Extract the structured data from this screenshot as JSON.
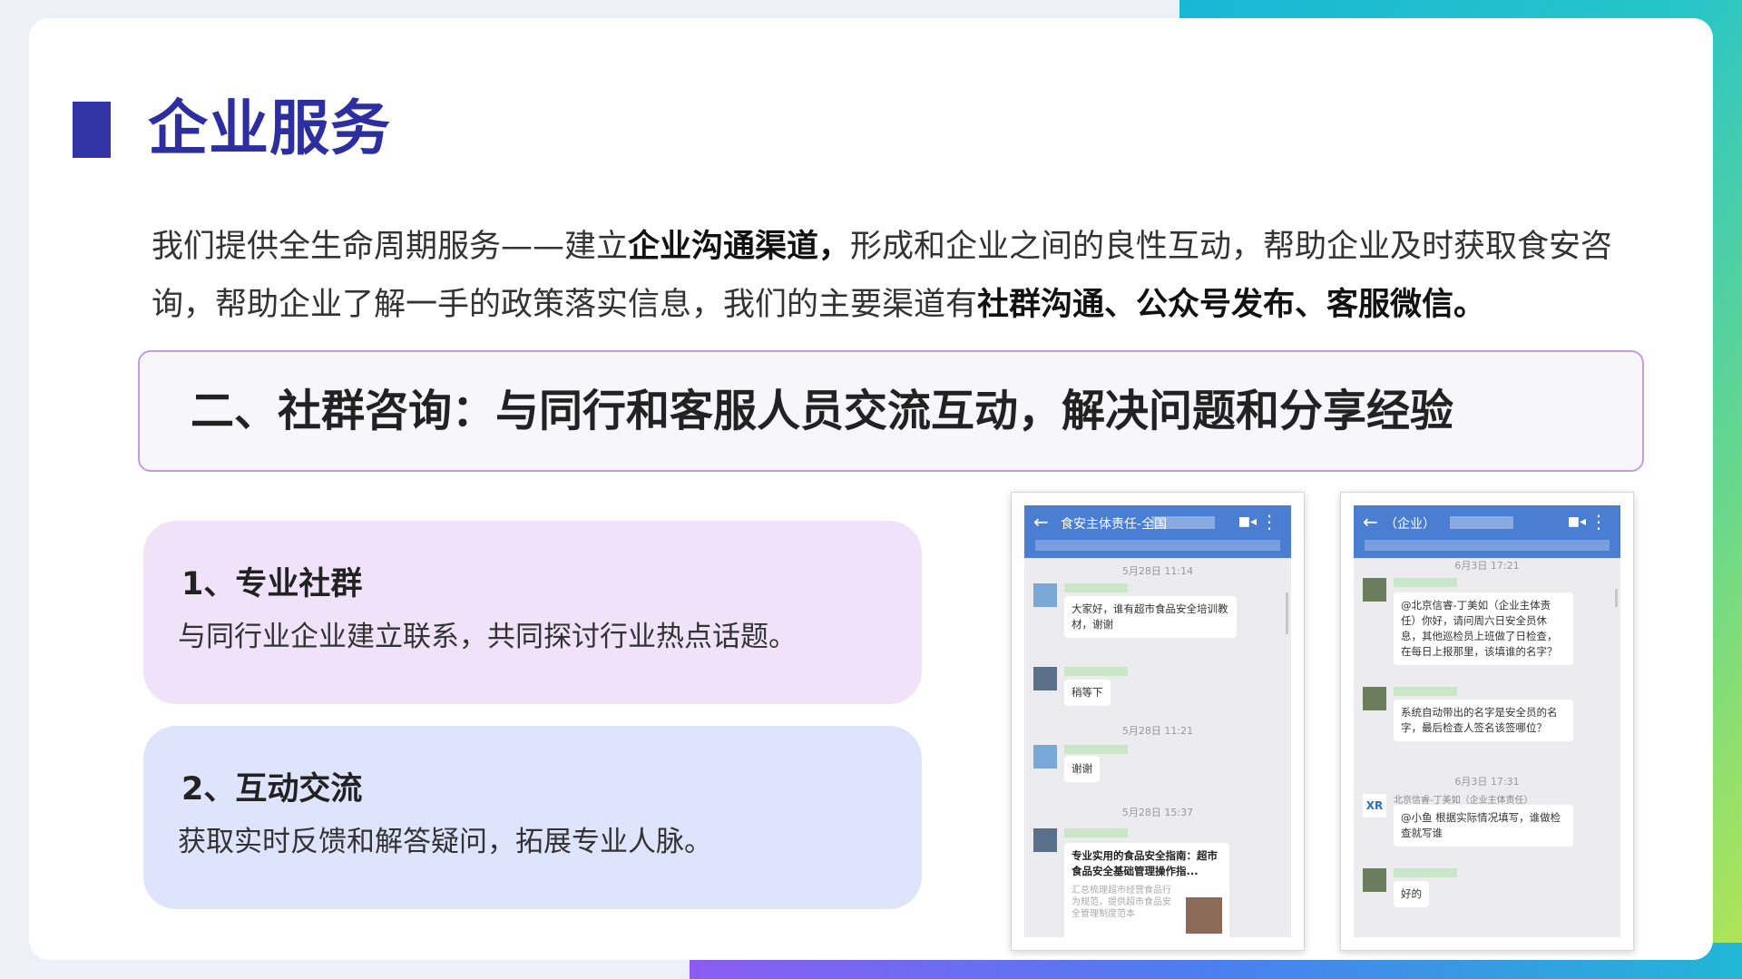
{
  "page": {
    "title": "企业服务",
    "intro_parts": [
      {
        "text": "我们提供全生命周期服务——建立",
        "bold": false
      },
      {
        "text": "企业沟通渠道，",
        "bold": true
      },
      {
        "text": "形成和企业之间的良性互动，帮助企业及时获取食安咨询，帮助企业了解一手的政策落实信息，我们的主要渠道有",
        "bold": false
      },
      {
        "text": "社群沟通、公众号发布、客服微信。",
        "bold": true
      }
    ],
    "section_title": "二、社群咨询：与同行和客服人员交流互动，解决问题和分享经验"
  },
  "features": [
    {
      "title": "1、专业社群",
      "desc": "与同行业企业建立联系，共同探讨行业热点话题。",
      "bg": "#efe2f9"
    },
    {
      "title": "2、互动交流",
      "desc": "获取实时反馈和解答疑问，拓展专业人脉。",
      "bg": "#dde4fb"
    }
  ],
  "phones": [
    {
      "group_name": "食安主体责任-全国",
      "messages": [
        {
          "time": "5月28日 11:14"
        },
        {
          "text": "大家好，谁有超市食品安全培训教材，谢谢"
        },
        {
          "text": "稍等下"
        },
        {
          "time": "5月28日 11:21"
        },
        {
          "text": "谢谢"
        },
        {
          "time": "5月28日 15:37"
        },
        {
          "link_title": "专业实用的食品安全指南：超市食品安全基础管理操作指...",
          "link_sub": "汇总梳理超市经营食品行为规范，提供超市食品安全管理制度范本"
        }
      ]
    },
    {
      "group_name": "（企业）",
      "messages": [
        {
          "time": "6月3日 17:21"
        },
        {
          "text": "@北京信睿-丁美如（企业主体责任）你好，请问周六日安全员休息，其他巡检员上班做了日检查，在每日上报那里，该填谁的名字？"
        },
        {
          "text": "系统自动带出的名字是安全员的名字，最后检查人签名该签哪位？"
        },
        {
          "time": "6月3日 17:31"
        },
        {
          "sender": "北京信睿-丁美如（企业主体责任）",
          "text": "@小鱼 根据实际情况填写，谁做检查就写谁"
        },
        {
          "text": "好的"
        }
      ]
    }
  ],
  "colors": {
    "title": "#2d2fa0",
    "banner_border": "#c59be6",
    "chat_header": "#4a7ed2"
  },
  "icons": {
    "back": "arrow-left-icon",
    "video": "video-call-icon",
    "more": "more-vertical-icon"
  }
}
